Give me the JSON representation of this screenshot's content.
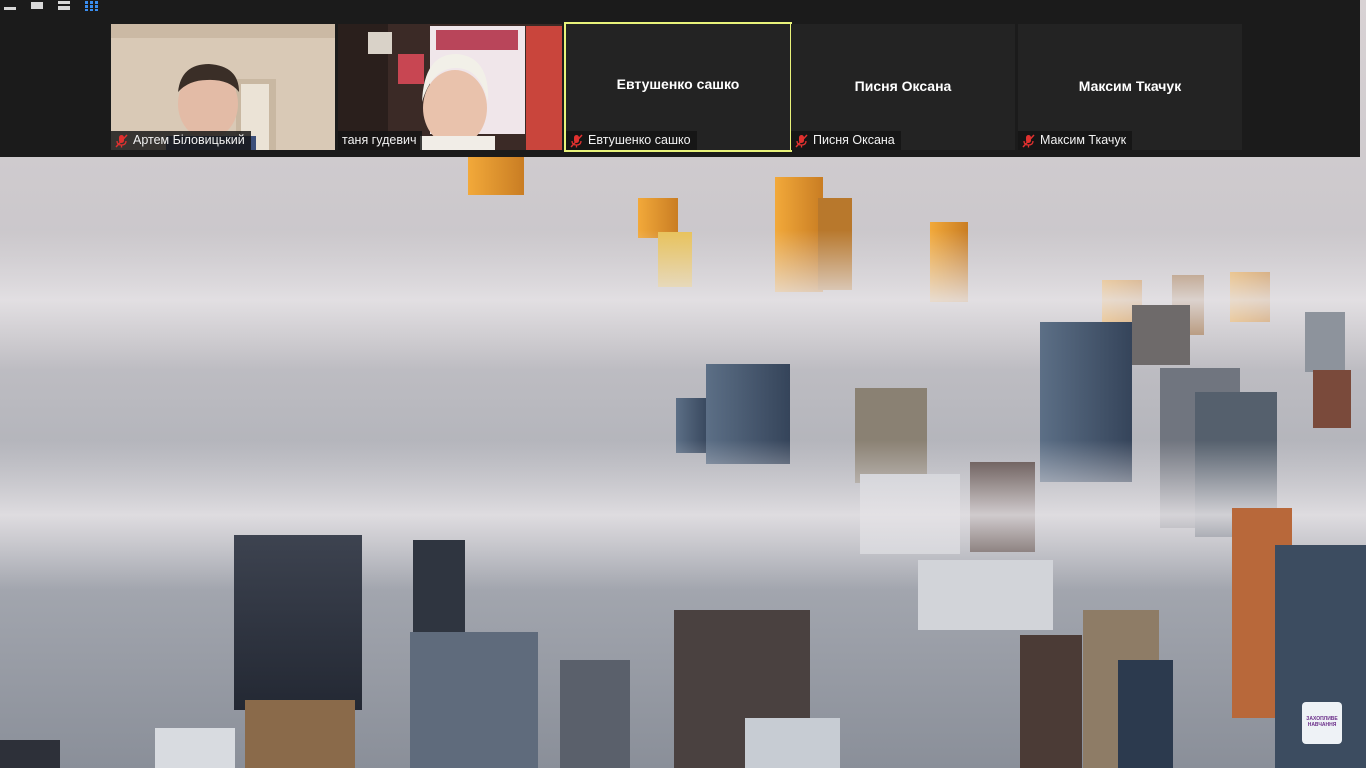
{
  "window": {
    "view_controls": [
      "minimize-icon",
      "single-view-icon",
      "strip-view-icon",
      "gallery-view-icon"
    ],
    "active_view": "gallery-view-icon"
  },
  "participants": [
    {
      "name": "Артем Біловицький",
      "muted": true,
      "video": true
    },
    {
      "name": "таня гудевич",
      "muted": false,
      "video": true
    },
    {
      "name": "Евтушенко сашко",
      "muted": true,
      "video": false,
      "active_speaker": true
    },
    {
      "name": "Писня Оксана",
      "muted": true,
      "video": false
    },
    {
      "name": "Максим Ткачук",
      "muted": true,
      "video": false
    }
  ],
  "shared_screen": {
    "content": "city-in-fog-photo"
  },
  "watermark": {
    "text": "ЗАХОПЛИВЕ НАВЧАННЯ"
  },
  "colors": {
    "active_border": "#e8f27a",
    "mic_off": "#e0312f",
    "grid_icon": "#3a8ef0",
    "tile_bg": "#232323"
  }
}
